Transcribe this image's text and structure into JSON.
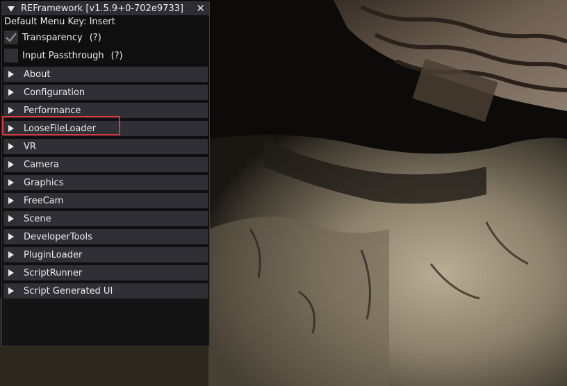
{
  "window": {
    "title": "REFramework [v1.5.9+0-702e9733]",
    "menu_key": "Default Menu Key: Insert"
  },
  "options": [
    {
      "label": "Transparency",
      "help": "(?)",
      "checked": true
    },
    {
      "label": "Input Passthrough",
      "help": "(?)",
      "checked": false
    }
  ],
  "sections": [
    "About",
    "Configuration",
    "Performance",
    "LooseFileLoader",
    "VR",
    "Camera",
    "Graphics",
    "FreeCam",
    "Scene",
    "DeveloperTools",
    "PluginLoader",
    "ScriptRunner",
    "Script Generated UI"
  ],
  "colors": {
    "highlight": "#e0343a",
    "header_bg": "#2f2f35",
    "window_bg": "#101012"
  }
}
